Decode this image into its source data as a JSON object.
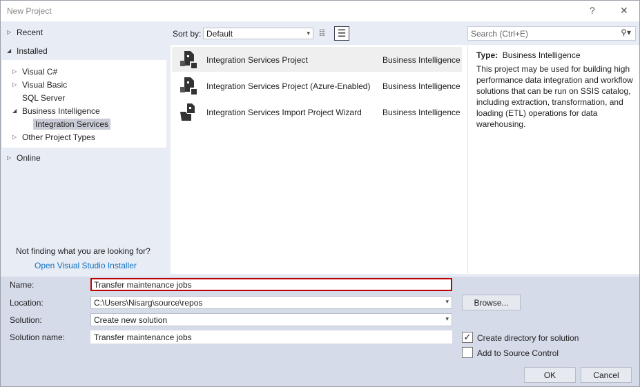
{
  "window": {
    "title": "New Project",
    "help": "?",
    "close": "✕"
  },
  "tree": {
    "recent": "Recent",
    "installed": "Installed",
    "online": "Online",
    "items": [
      {
        "label": "Visual C#"
      },
      {
        "label": "Visual Basic"
      },
      {
        "label": "SQL Server"
      },
      {
        "label": "Business Intelligence"
      },
      {
        "label": "Integration Services"
      },
      {
        "label": "Other Project Types"
      }
    ],
    "not_finding": "Not finding what you are looking for?",
    "installer_link": "Open Visual Studio Installer"
  },
  "toolbar": {
    "sort_label": "Sort by:",
    "sort_value": "Default",
    "search_placeholder": "Search (Ctrl+E)"
  },
  "templates": [
    {
      "name": "Integration Services Project",
      "category": "Business Intelligence"
    },
    {
      "name": "Integration Services Project (Azure-Enabled)",
      "category": "Business Intelligence"
    },
    {
      "name": "Integration Services Import Project Wizard",
      "category": "Business Intelligence"
    }
  ],
  "detail": {
    "type_label": "Type:",
    "type_value": "Business Intelligence",
    "description": "This project may be used for building high performance data integration and workflow solutions that can be run on SSIS catalog, including extraction, transformation, and loading (ETL) operations for data warehousing."
  },
  "form": {
    "name_label": "Name:",
    "name_value": "Transfer maintenance jobs",
    "location_label": "Location:",
    "location_value": "C:\\Users\\Nisarg\\source\\repos",
    "solution_label": "Solution:",
    "solution_value": "Create new solution",
    "solution_name_label": "Solution name:",
    "solution_name_value": "Transfer maintenance jobs",
    "browse": "Browse...",
    "create_dir": "Create directory for solution",
    "create_dir_checked": true,
    "source_control": "Add to Source Control",
    "source_control_checked": false,
    "ok": "OK",
    "cancel": "Cancel"
  },
  "colors": {
    "highlight_border": "#c00000"
  }
}
